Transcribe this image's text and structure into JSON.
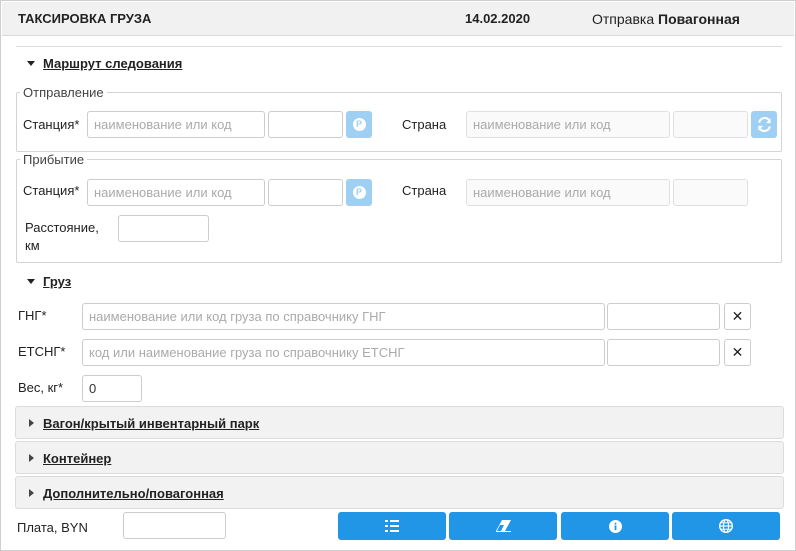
{
  "header": {
    "title": "ТАКСИРОВКА ГРУЗА",
    "date": "14.02.2020",
    "shipment_label": "Отправка",
    "shipment_value": "Повагонная"
  },
  "route": {
    "title": "Маршрут следования",
    "departure": {
      "legend": "Отправление",
      "station_label": "Станция*",
      "station_placeholder": "наименование или код",
      "code_value": "",
      "country_label": "Страна",
      "country_placeholder": "наименование или код",
      "country_code_value": ""
    },
    "arrival": {
      "legend": "Прибытие",
      "station_label": "Станция*",
      "station_placeholder": "наименование или код",
      "code_value": "",
      "country_label": "Страна",
      "country_placeholder": "наименование или код",
      "country_code_value": "",
      "distance_label_1": "Расстояние,",
      "distance_label_2": "км",
      "distance_value": ""
    }
  },
  "cargo": {
    "title": "Груз",
    "gng_label": "ГНГ*",
    "gng_placeholder": "наименование или код груза по справочнику ГНГ",
    "etsng_label": "ЕТСНГ*",
    "etsng_placeholder": "код или наименование груза по справочнику ЕТСНГ",
    "weight_label": "Вес, кг*",
    "weight_value": "0",
    "clear_symbol": "✕"
  },
  "sections": [
    {
      "title": "Вагон/крытый инвентарный парк"
    },
    {
      "title": "Контейнер"
    },
    {
      "title": "Дополнительно/повагонная"
    }
  ],
  "footer": {
    "fee_label": "Плата, BYN",
    "fee_value": ""
  },
  "icons": {
    "p_button": "P",
    "info": "i"
  },
  "colors": {
    "primary": "#2196e6",
    "light_button": "#9fd0f4"
  }
}
